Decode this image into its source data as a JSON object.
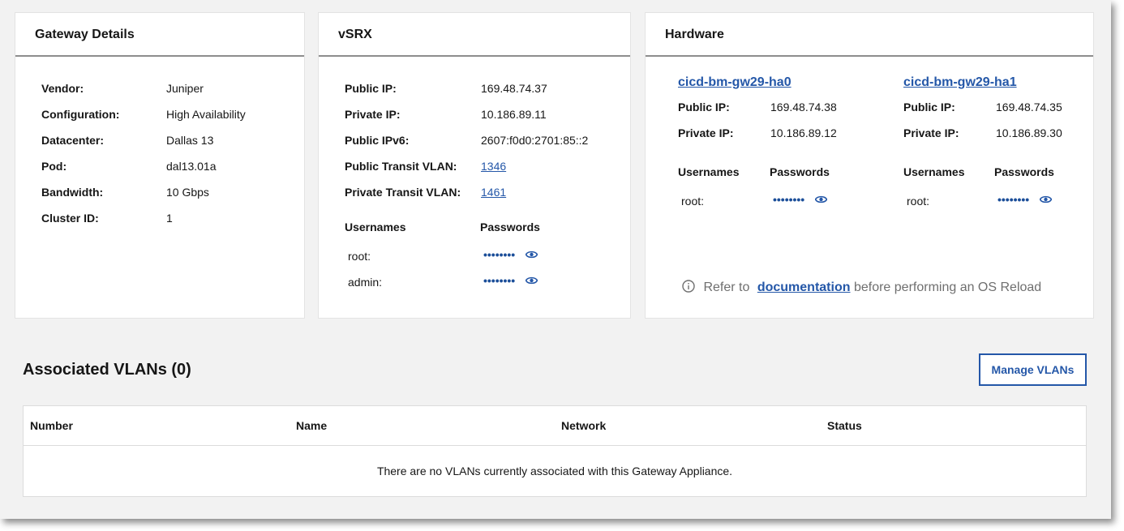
{
  "gateway": {
    "title": "Gateway Details",
    "rows": [
      {
        "label": "Vendor:",
        "value": "Juniper"
      },
      {
        "label": "Configuration:",
        "value": "High Availability"
      },
      {
        "label": "Datacenter:",
        "value": "Dallas 13"
      },
      {
        "label": "Pod:",
        "value": "dal13.01a"
      },
      {
        "label": "Bandwidth:",
        "value": "10 Gbps"
      },
      {
        "label": "Cluster ID:",
        "value": "1"
      }
    ]
  },
  "vsrx": {
    "title": "vSRX",
    "public_ip_label": "Public IP:",
    "public_ip": "169.48.74.37",
    "private_ip_label": "Private IP:",
    "private_ip": "10.186.89.11",
    "public_ipv6_label": "Public IPv6:",
    "public_ipv6": "2607:f0d0:2701:85::2",
    "public_transit_label": "Public Transit VLAN:",
    "public_transit": "1346",
    "private_transit_label": "Private Transit VLAN:",
    "private_transit": "1461",
    "usernames_header": "Usernames",
    "passwords_header": "Passwords",
    "credentials": [
      {
        "user": "root:",
        "password": "••••••••"
      },
      {
        "user": "admin:",
        "password": "••••••••"
      }
    ]
  },
  "hardware": {
    "title": "Hardware",
    "members": [
      {
        "name": "cicd-bm-gw29-ha0",
        "public_ip_label": "Public IP:",
        "public_ip": "169.48.74.38",
        "private_ip_label": "Private IP:",
        "private_ip": "10.186.89.12",
        "usernames_header": "Usernames",
        "passwords_header": "Passwords",
        "user": "root:",
        "password": "••••••••"
      },
      {
        "name": "cicd-bm-gw29-ha1",
        "public_ip_label": "Public IP:",
        "public_ip": "169.48.74.35",
        "private_ip_label": "Private IP:",
        "private_ip": "10.186.89.30",
        "usernames_header": "Usernames",
        "passwords_header": "Passwords",
        "user": "root:",
        "password": "••••••••"
      }
    ],
    "note_prefix": "Refer to",
    "note_link": "documentation",
    "note_suffix": "before performing an OS Reload"
  },
  "vlans": {
    "title": "Associated VLANs (0)",
    "manage_label": "Manage VLANs",
    "columns": [
      "Number",
      "Name",
      "Network",
      "Status"
    ],
    "empty_message": "There are no VLANs currently associated with this Gateway Appliance."
  },
  "colors": {
    "link": "#2457a8",
    "header_rule": "#8d8d8d",
    "background": "#f2f2f2"
  }
}
